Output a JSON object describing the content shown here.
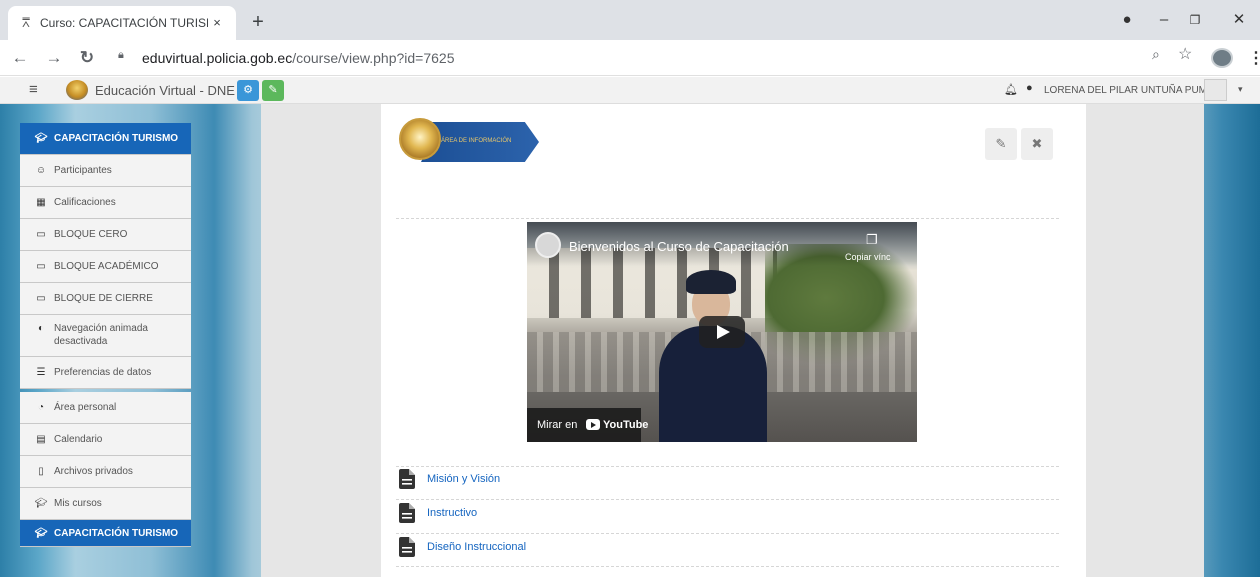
{
  "browser": {
    "tab_title": "Curso: CAPACITACIÓN TURISMO",
    "tab_close": "×",
    "new_tab": "+",
    "url_host": "eduvirtual.policia.gob.ec",
    "url_path": "/course/view.php?id=7625"
  },
  "navbar": {
    "site_name": "Educación Virtual - DNE",
    "user_name": "LORENA DEL PILAR UNTUÑA PUMA"
  },
  "drawer": {
    "course_title": "CAPACITACIÓN TURISMO",
    "items": [
      {
        "label": "Participantes",
        "icon": "users-icon"
      },
      {
        "label": "Calificaciones",
        "icon": "table-icon"
      },
      {
        "label": "BLOQUE CERO",
        "icon": "folder-icon"
      },
      {
        "label": "BLOQUE ACADÉMICO",
        "icon": "folder-icon"
      },
      {
        "label": "BLOQUE DE CIERRE",
        "icon": "folder-icon"
      },
      {
        "label": "Navegación animada desactivada",
        "icon": "toggle-icon"
      },
      {
        "label": "Preferencias de datos",
        "icon": "database-icon"
      },
      {
        "label": "Área personal",
        "icon": "dashboard-icon"
      },
      {
        "label": "Calendario",
        "icon": "calendar-icon"
      },
      {
        "label": "Archivos privados",
        "icon": "file-icon"
      },
      {
        "label": "Mis cursos",
        "icon": "graduation-cap-icon"
      }
    ],
    "footer_title": "CAPACITACIÓN TURISMO"
  },
  "section": {
    "banner_text": "ÁREA DE INFORMACIÓN"
  },
  "video": {
    "title": "Bienvenidos al Curso de Capacitación",
    "copy_label": "Copiar vínc",
    "watch_on": "Mirar en",
    "youtube": "YouTube"
  },
  "resources": [
    {
      "label": "Misión y Visión"
    },
    {
      "label": "Instructivo"
    },
    {
      "label": "Diseño Instruccional"
    }
  ],
  "colors": {
    "brand_blue": "#1766b8",
    "link": "#1565c0",
    "accent_blue_button": "#3a96d8",
    "accent_green_button": "#5cb85c"
  }
}
